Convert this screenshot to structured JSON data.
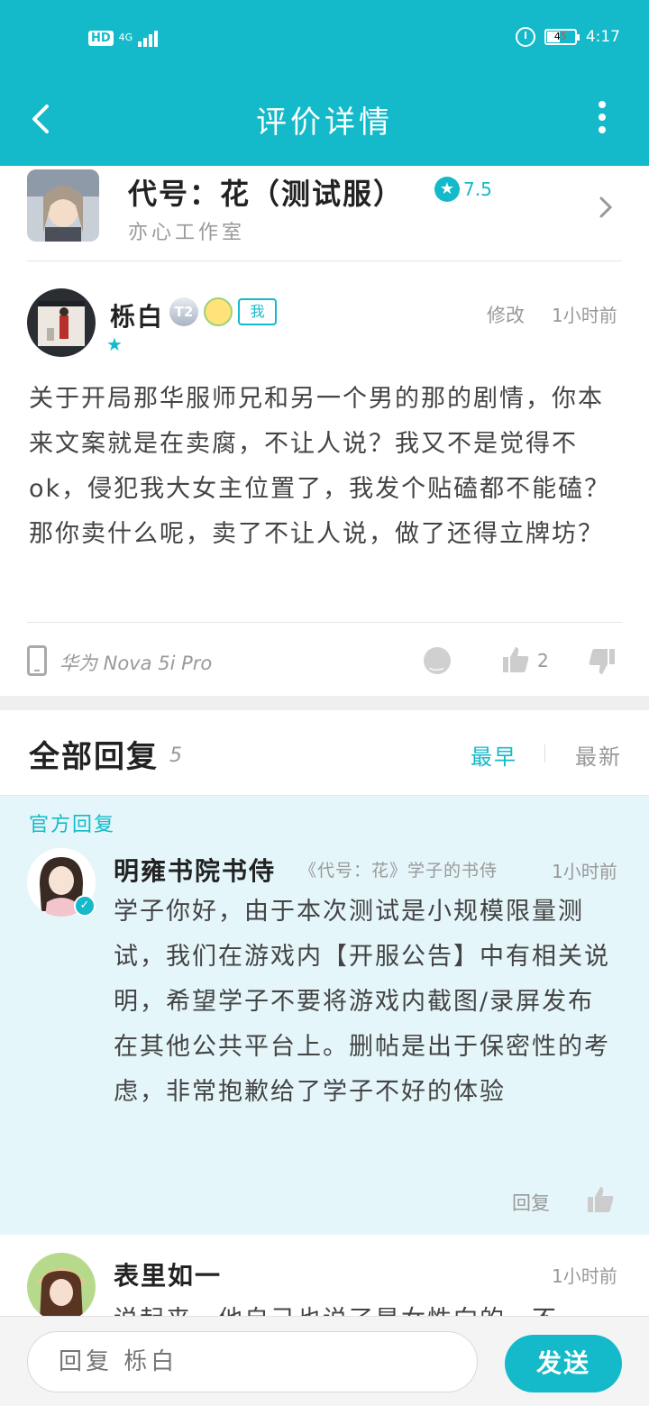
{
  "status_bar": {
    "hd": "HD",
    "network": "4G",
    "battery": "45",
    "time": "4:17"
  },
  "appbar": {
    "title": "评价详情"
  },
  "game": {
    "title": "代号：花（测试服）",
    "rating": "7.5",
    "studio": "亦心工作室"
  },
  "review": {
    "user": "栎白",
    "level_badge": "T2",
    "me_tag": "我",
    "edit": "修改",
    "time": "1小时前",
    "text": "关于开局那华服师兄和另一个男的那的剧情，你本来文案就是在卖腐，不让人说？我又不是觉得不ok，侵犯我大女主位置了，我发个贴磕都不能磕？那你卖什么呢，卖了不让人说，做了还得立牌坊？",
    "device": "华为 Nova 5i Pro",
    "like_count": "2"
  },
  "replies": {
    "title": "全部回复",
    "count": "5",
    "sort_earliest": "最早",
    "sort_latest": "最新"
  },
  "official_reply": {
    "label": "官方回复",
    "name": "明雍书院书侍",
    "role": "《代号：花》学子的书侍",
    "time": "1小时前",
    "text": "学子你好，由于本次测试是小规模限量测试，我们在游戏内【开服公告】中有相关说明，希望学子不要将游戏内截图/录屏发布在其他公共平台上。删帖是出于保密性的考虑，非常抱歉给了学子不好的体验",
    "reply_label": "回复"
  },
  "second_reply": {
    "name": "表里如一",
    "time": "1小时前",
    "text": "说起来，他自己也说了是女性向的，不"
  },
  "bottom_bar": {
    "placeholder": "回复 栎白",
    "send": "发送"
  },
  "colors": {
    "accent": "#14bac9",
    "official_bg": "#e5f6fa"
  }
}
